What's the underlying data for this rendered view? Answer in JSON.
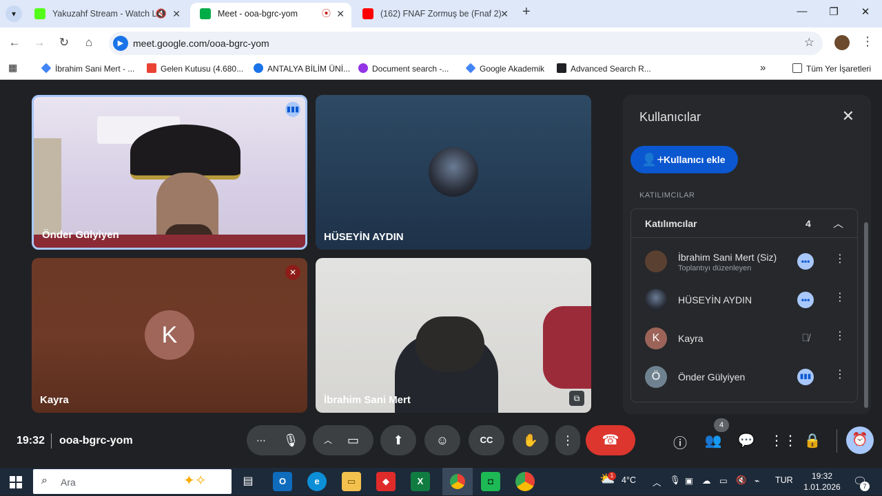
{
  "browser": {
    "tabs": [
      {
        "title": "Yakuzahf Stream - Watch Li",
        "extra": "🔇",
        "favicon_color": "#53fc18"
      },
      {
        "title": "Meet - ooa-bgrc-yom",
        "extra": "⦿",
        "favicon_color": "#00ac47"
      },
      {
        "title": "(162) FNAF Zormuş be (Fnaf 2)",
        "extra": "",
        "favicon_color": "#ff0000"
      }
    ],
    "url": "meet.google.com/ooa-bgrc-yom",
    "bookmarks": [
      {
        "label": "İbrahim Sani Mert - ...",
        "color": "#4285f4"
      },
      {
        "label": "Gelen Kutusu (4.680...",
        "color": "#ea4335"
      },
      {
        "label": "ANTALYA BİLİM ÜNİ...",
        "color": "#1a73e8"
      },
      {
        "label": "Document search -...",
        "color": "#9334e6"
      },
      {
        "label": "Google Akademik",
        "color": "#4285f4"
      },
      {
        "label": "Advanced Search R...",
        "color": "#202124"
      }
    ],
    "bookmarks_folder": "Tüm Yer İşaretleri",
    "tab_close_glyph": "✕",
    "new_tab_glyph": "+",
    "overflow_glyph": "»"
  },
  "meet": {
    "tiles": [
      {
        "name": "Önder Gülyiyen",
        "status": "speaking"
      },
      {
        "name": "HÜSEYİN AYDIN",
        "status": ""
      },
      {
        "name": "Kayra",
        "initial": "K",
        "status": "muted"
      },
      {
        "name": "İbrahim Sani Mert",
        "status": ""
      }
    ],
    "panel": {
      "title": "Kullanıcılar",
      "add_button": "Kullanıcı ekle",
      "section_label": "KATILIMCILAR",
      "group_title": "Katılımcılar",
      "group_count": "4",
      "participants": [
        {
          "name": "İbrahim Sani Mert (Siz)",
          "role": "Toplantıyı düzenleyen",
          "initial": "",
          "status": "more"
        },
        {
          "name": "HÜSEYİN AYDIN",
          "role": "",
          "initial": "",
          "status": "more"
        },
        {
          "name": "Kayra",
          "role": "",
          "initial": "K",
          "status": "muted"
        },
        {
          "name": "Önder Gülyiyen",
          "role": "",
          "initial": "Ö",
          "status": "speaking"
        }
      ]
    },
    "controls": {
      "time": "19:32",
      "meeting_code": "ooa-bgrc-yom",
      "people_badge": "4"
    }
  },
  "taskbar": {
    "search_placeholder": "Ara",
    "weather": "4°C",
    "language": "TUR",
    "clock_time": "19:32",
    "clock_date": "1.01.2026",
    "notification_count": "7",
    "weather_badge": "1"
  },
  "colors": {
    "meet_bg": "#202124",
    "end_call": "#dc362e",
    "primary_blue": "#0b57d0",
    "speaking_blue": "#a8c7fa",
    "muted_red": "#8c1d18"
  }
}
